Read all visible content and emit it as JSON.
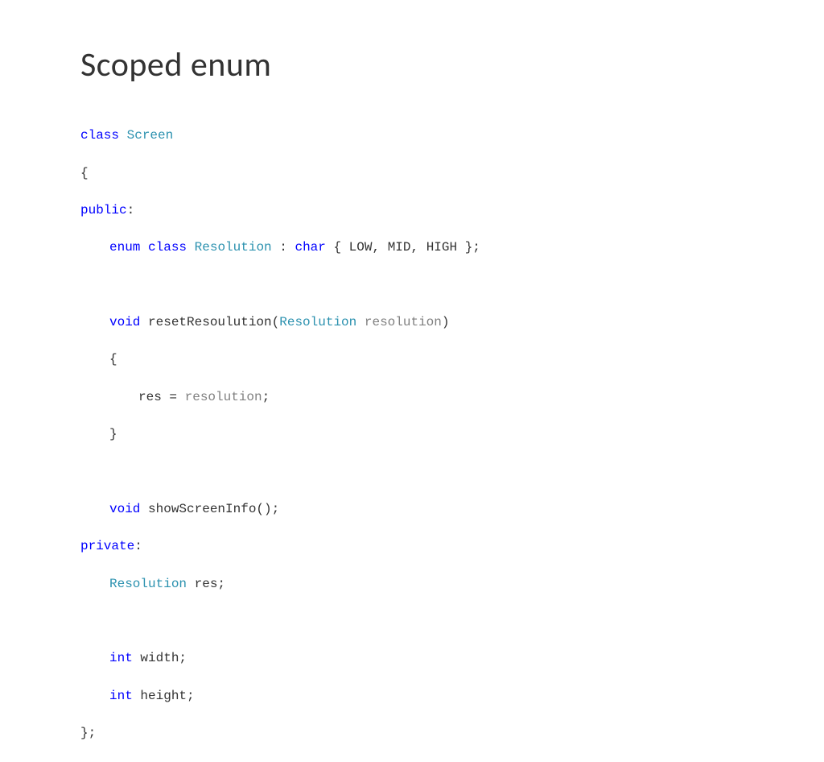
{
  "title": "Scoped enum",
  "code": {
    "kw_class": "class",
    "cls_name": "Screen",
    "brace_open": "{",
    "kw_public": "public",
    "colon1": ":",
    "kw_enum": "enum",
    "kw_class2": "class",
    "enum_name": "Resolution",
    "colon2": " : ",
    "kw_char": "char",
    "enum_body": " { LOW, MID, HIGH };",
    "kw_void1": "void",
    "fn_reset": " resetResoulution(",
    "param_type": "Resolution",
    "space1": " ",
    "param_name": "resolution",
    "paren_close": ")",
    "fn_brace_open": "{",
    "assign_lhs": "res = ",
    "assign_rhs": "resolution",
    "semicolon2": ";",
    "fn_brace_close": "}",
    "kw_void2": "void",
    "fn_show": " showScreenInfo();",
    "kw_private": "private",
    "colon3": ":",
    "res_type": "Resolution",
    "res_decl": " res;",
    "kw_int1": "int",
    "width_decl": " width;",
    "kw_int2": "int",
    "height_decl": " height;",
    "cls_close": "};"
  }
}
